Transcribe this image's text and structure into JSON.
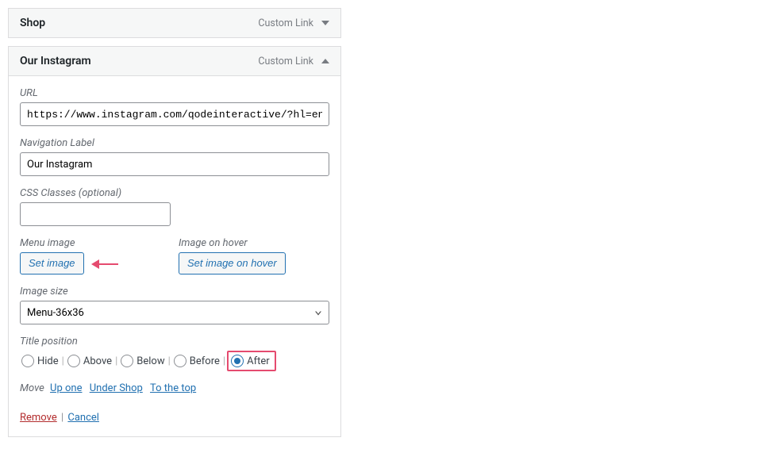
{
  "items": [
    {
      "title": "Shop",
      "type": "Custom Link",
      "expanded": false
    },
    {
      "title": "Our Instagram",
      "type": "Custom Link",
      "expanded": true,
      "fields": {
        "url_label": "URL",
        "url_value": "https://www.instagram.com/qodeinteractive/?hl=en",
        "nav_label": "Navigation Label",
        "nav_value": "Our Instagram",
        "css_label": "CSS Classes (optional)",
        "css_value": "",
        "menu_image_label": "Menu image",
        "set_image_btn": "Set image",
        "hover_image_label": "Image on hover",
        "set_hover_btn": "Set image on hover",
        "image_size_label": "Image size",
        "image_size_value": "Menu-36x36",
        "title_pos_label": "Title position",
        "title_pos_options": {
          "hide": "Hide",
          "above": "Above",
          "below": "Below",
          "before": "Before",
          "after": "After"
        },
        "title_pos_selected": "after",
        "move_label": "Move",
        "move_links": {
          "up_one": "Up one",
          "under_shop": "Under Shop",
          "to_top": "To the top"
        },
        "remove": "Remove",
        "cancel": "Cancel"
      }
    }
  ]
}
